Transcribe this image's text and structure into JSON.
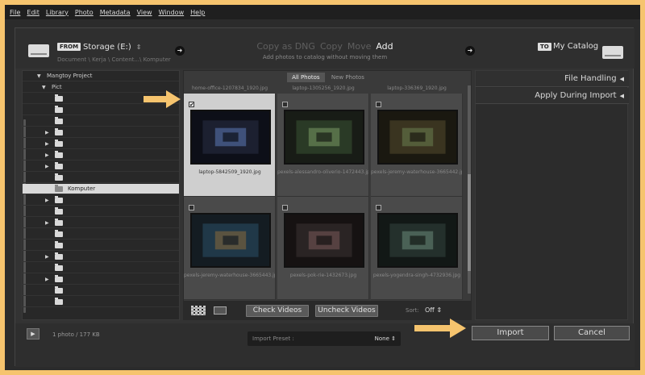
{
  "menu": [
    "File",
    "Edit",
    "Library",
    "Photo",
    "Metadata",
    "View",
    "Window",
    "Help"
  ],
  "source": {
    "tag": "FROM",
    "name": "Storage (E:)",
    "caret": "⇕",
    "path": "Document \\ Kerja \\ Content...\\ Komputer"
  },
  "modes": {
    "items": [
      "Copy as DNG",
      "Copy",
      "Move",
      "Add"
    ],
    "active": "Add",
    "description": "Add photos to catalog without moving them"
  },
  "destination": {
    "tag": "TO",
    "name": "My Catalog"
  },
  "tree": [
    {
      "label": "Mangtoy Project",
      "arrow": "▼",
      "folder": false,
      "indent": 0
    },
    {
      "label": "Pict",
      "arrow": "▼",
      "folder": false,
      "indent": 1
    },
    {
      "label": "",
      "arrow": "",
      "folder": true
    },
    {
      "label": "",
      "arrow": "",
      "folder": true
    },
    {
      "label": "",
      "arrow": "",
      "folder": true
    },
    {
      "label": "",
      "arrow": "▶",
      "folder": true
    },
    {
      "label": "",
      "arrow": "▶",
      "folder": true
    },
    {
      "label": "",
      "arrow": "▶",
      "folder": true
    },
    {
      "label": "",
      "arrow": "▶",
      "folder": true
    },
    {
      "label": "",
      "arrow": "",
      "folder": true
    },
    {
      "label": "Komputer",
      "arrow": "",
      "folder": true,
      "selected": true
    },
    {
      "label": "",
      "arrow": "▶",
      "folder": true
    },
    {
      "label": "",
      "arrow": "",
      "folder": true
    },
    {
      "label": "",
      "arrow": "▶",
      "folder": true
    },
    {
      "label": "",
      "arrow": "",
      "folder": true
    },
    {
      "label": "",
      "arrow": "",
      "folder": true
    },
    {
      "label": "",
      "arrow": "▶",
      "folder": true
    },
    {
      "label": "",
      "arrow": "",
      "folder": true
    },
    {
      "label": "",
      "arrow": "▶",
      "folder": true
    },
    {
      "label": "",
      "arrow": "",
      "folder": true
    },
    {
      "label": "",
      "arrow": "",
      "folder": true
    }
  ],
  "filter_tabs": {
    "all": "All Photos",
    "new": "New Photos"
  },
  "top_filenames": [
    "home-office-1207834_1920.jpg",
    "laptop-1305256_1920.jpg",
    "laptop-336369_1920.jpg"
  ],
  "photos": [
    {
      "name": "laptop-5842509_1920.jpg",
      "checked": true,
      "selected": true,
      "check_mark": "✔",
      "palette": [
        "#1c2030",
        "#0d0f18",
        "#5d7ab8"
      ]
    },
    {
      "name": "pexels-alessandro-oliverio-1472443.jpg",
      "checked": false,
      "selected": false,
      "check_mark": "",
      "palette": [
        "#2a3a26",
        "#181c16",
        "#7a9a64"
      ]
    },
    {
      "name": "pexels-jeremy-waterhouse-3665442.jpg",
      "checked": false,
      "selected": false,
      "check_mark": "",
      "palette": [
        "#3a3420",
        "#1a1810",
        "#6a8050"
      ]
    },
    {
      "name": "pexels-jeremy-waterhouse-3665443.jpg",
      "checked": false,
      "selected": false,
      "check_mark": "",
      "palette": [
        "#203848",
        "#141c22",
        "#8a6a3a"
      ]
    },
    {
      "name": "pexels-pok-rie-1432673.jpg",
      "checked": false,
      "selected": false,
      "check_mark": "",
      "palette": [
        "#2a2424",
        "#161212",
        "#7a5a5a"
      ]
    },
    {
      "name": "pexels-yogendra-singh-4732936.jpg",
      "checked": false,
      "selected": false,
      "check_mark": "",
      "palette": [
        "#24302c",
        "#121816",
        "#6a8a7a"
      ]
    }
  ],
  "toolbar": {
    "check_videos": "Check Videos",
    "uncheck_videos": "Uncheck Videos",
    "sort_label": "Sort:",
    "sort_value": "Off ⇕"
  },
  "right_panel": {
    "file_handling": "File Handling",
    "apply_during_import": "Apply During Import",
    "collapse_glyph": "◀"
  },
  "footer": {
    "expand_glyph": "▶",
    "count": "1 photo / 177 KB",
    "preset_label": "Import Preset :",
    "preset_value": "None ⇕",
    "import": "Import",
    "cancel": "Cancel"
  },
  "colors": {
    "annotation_arrow": "#f6c46e",
    "background": "#f6c46e",
    "panel": "#2b2b2b"
  }
}
